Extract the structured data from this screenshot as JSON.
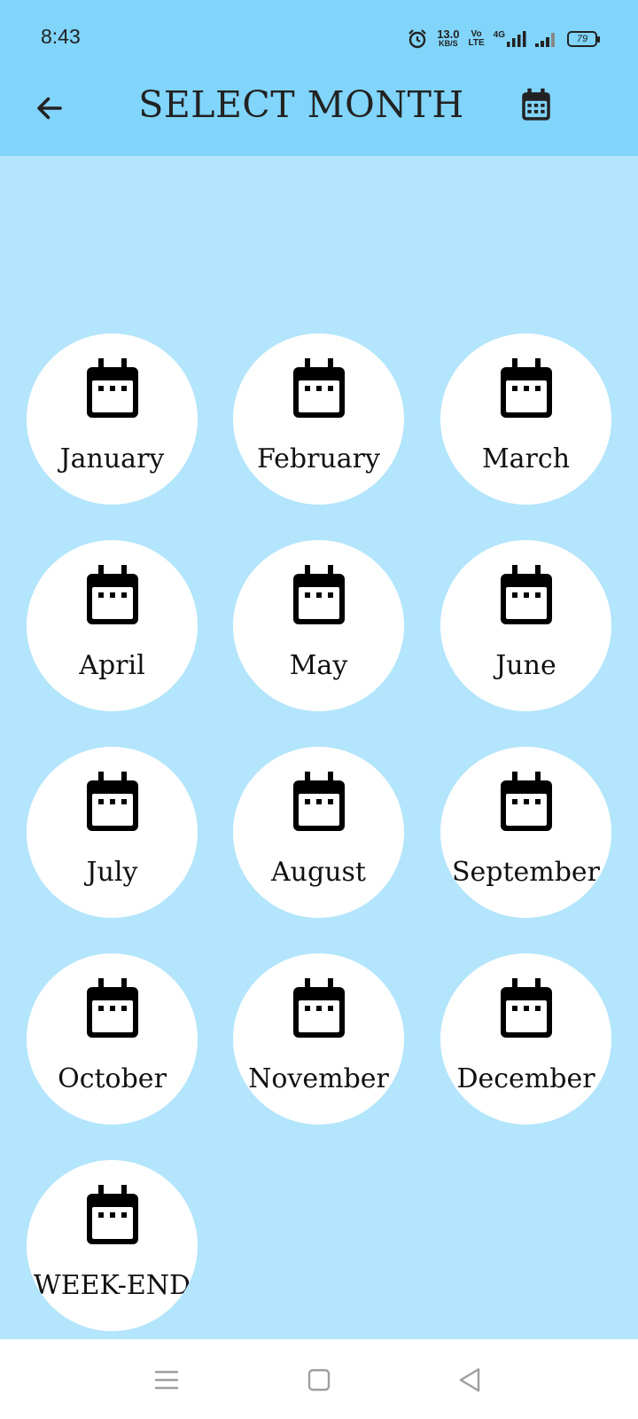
{
  "status_bar": {
    "time": "8:43",
    "net_speed_value": "13.0",
    "net_speed_unit": "KB/S",
    "volte_top": "Vo",
    "volte_bottom": "LTE",
    "network_type": "4G",
    "battery": "79",
    "icons": [
      "alarm-icon",
      "signal-icon",
      "signal-icon",
      "battery-icon"
    ]
  },
  "app_bar": {
    "title": "SELECT MONTH",
    "back_icon": "arrow-left-icon",
    "title_icon": "calendar-icon"
  },
  "months": [
    {
      "label": "January"
    },
    {
      "label": "February"
    },
    {
      "label": "March"
    },
    {
      "label": "April"
    },
    {
      "label": "May"
    },
    {
      "label": "June"
    },
    {
      "label": "July"
    },
    {
      "label": "August"
    },
    {
      "label": "September"
    },
    {
      "label": "October"
    },
    {
      "label": "November"
    },
    {
      "label": "December"
    },
    {
      "label": "WEEK-END"
    }
  ],
  "nav_bar": {
    "icons": [
      "menu-icon",
      "home-square-icon",
      "back-triangle-icon"
    ]
  },
  "colors": {
    "header_bg": "#81d4fa",
    "body_bg": "#b3e5fc",
    "card_bg": "#ffffff",
    "text": "#111111"
  }
}
